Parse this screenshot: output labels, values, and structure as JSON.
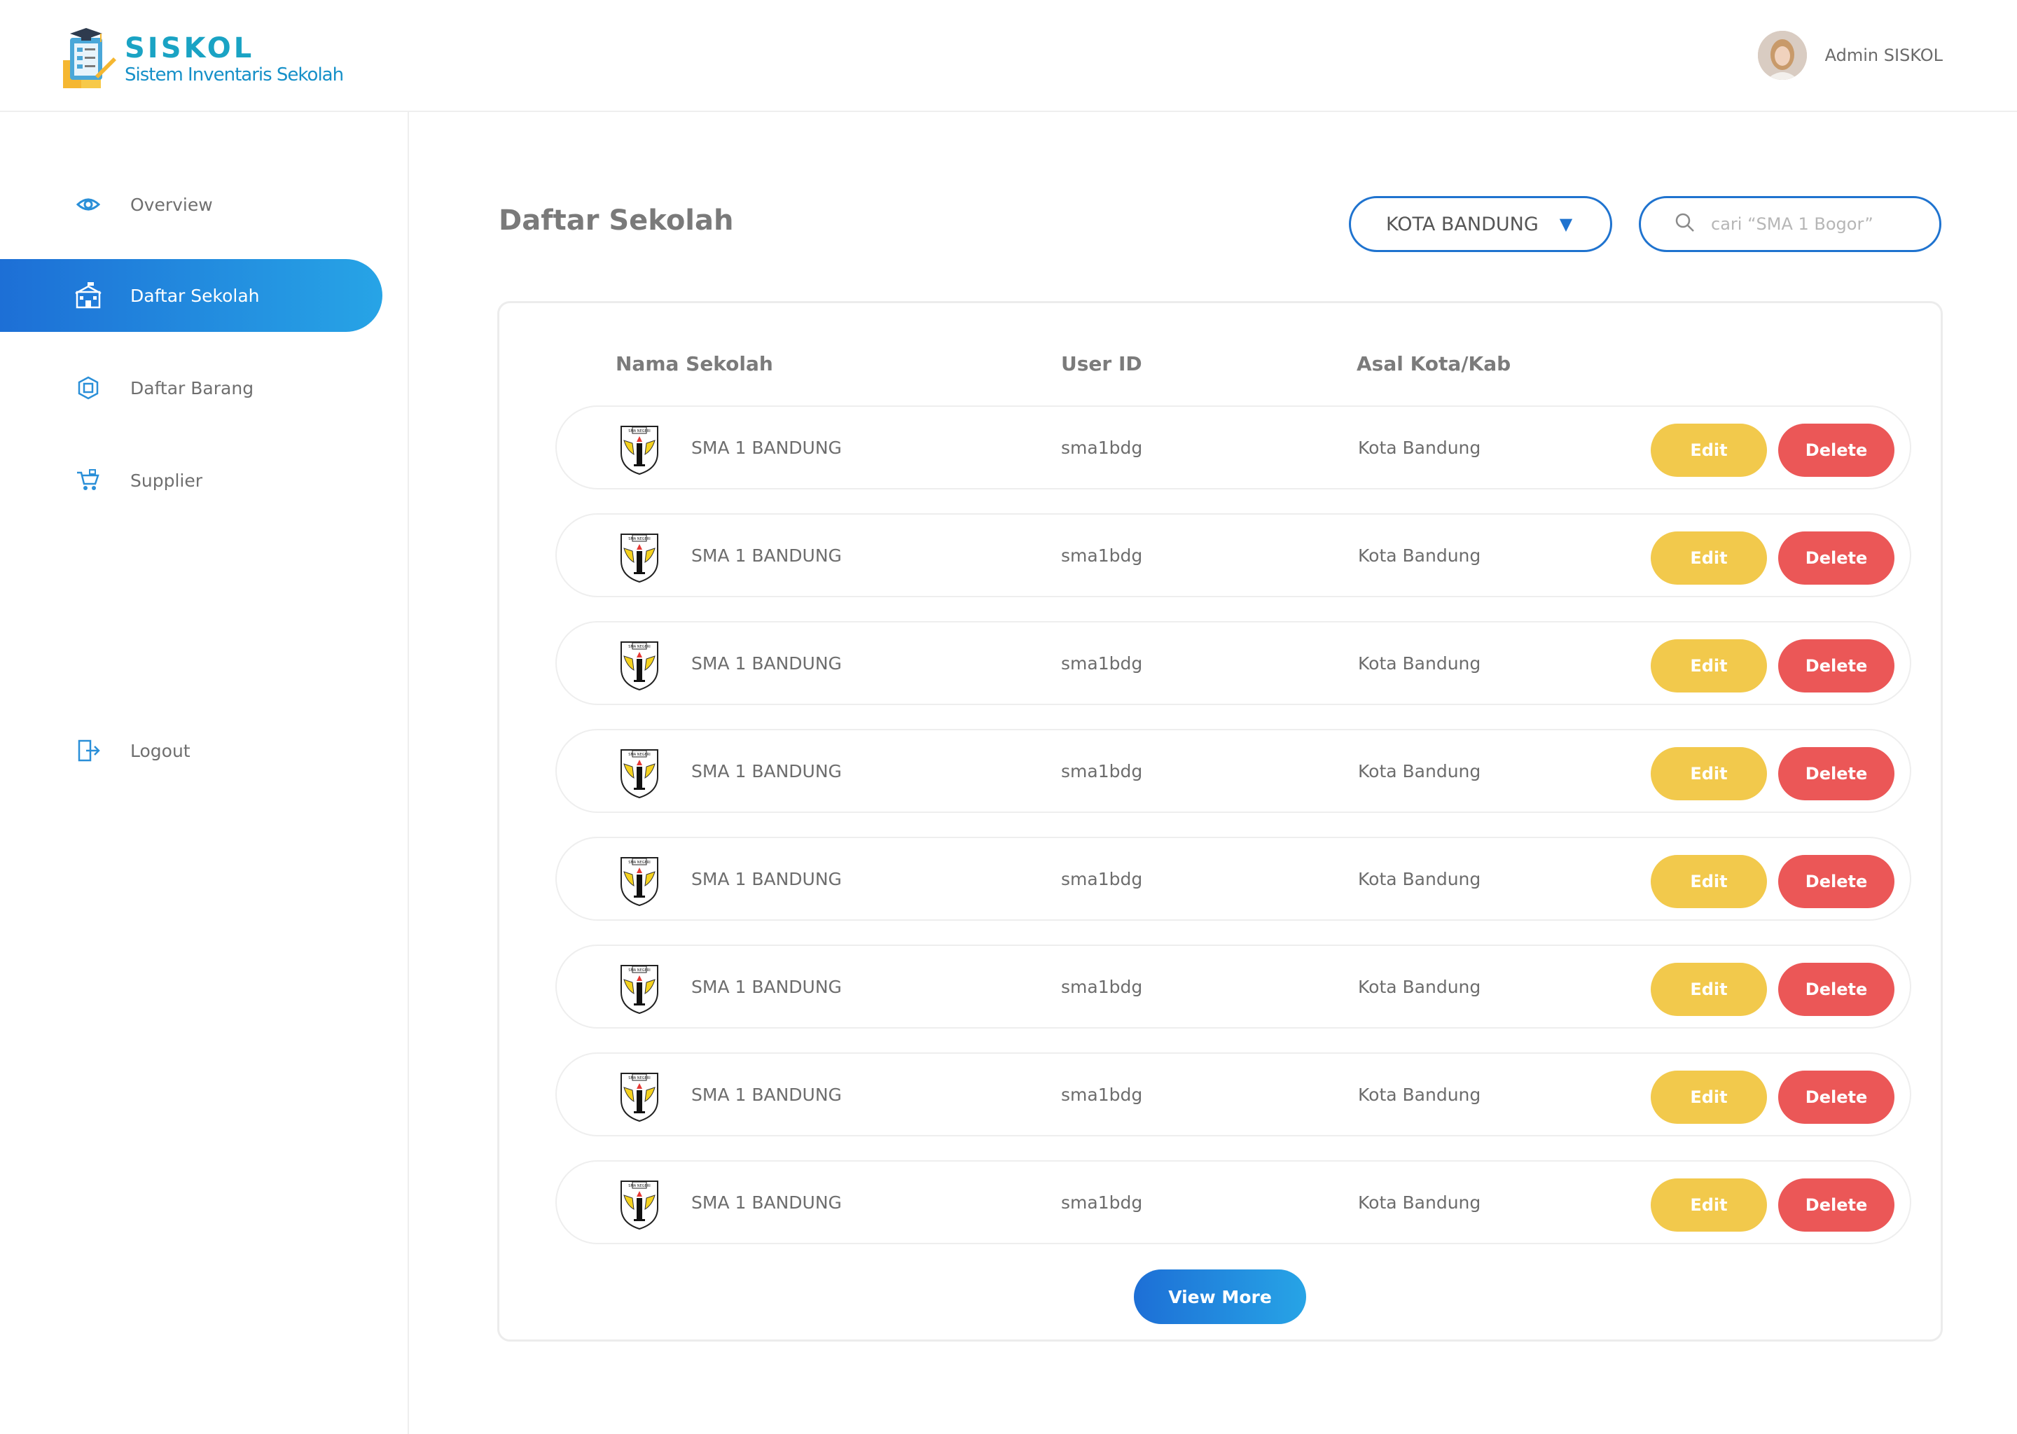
{
  "brand": {
    "title": "SISKOL",
    "subtitle": "Sistem Inventaris Sekolah"
  },
  "user": {
    "name": "Admin SISKOL"
  },
  "sidebar": {
    "items": [
      {
        "label": "Overview",
        "icon": "eye-icon"
      },
      {
        "label": "Daftar Sekolah",
        "icon": "school-icon",
        "active": true
      },
      {
        "label": "Daftar Barang",
        "icon": "box-icon"
      },
      {
        "label": "Supplier",
        "icon": "cart-icon"
      },
      {
        "label": "Logout",
        "icon": "logout-icon"
      }
    ]
  },
  "main": {
    "title": "Daftar Sekolah",
    "city_filter": {
      "selected": "KOTA BANDUNG"
    },
    "search": {
      "placeholder": "cari “SMA 1 Bogor”"
    },
    "table": {
      "headers": [
        "Nama Sekolah",
        "User ID",
        "Asal Kota/Kab"
      ],
      "rows": [
        {
          "name": "SMA 1 BANDUNG",
          "user_id": "sma1bdg",
          "city": "Kota Bandung"
        },
        {
          "name": "SMA 1 BANDUNG",
          "user_id": "sma1bdg",
          "city": "Kota Bandung"
        },
        {
          "name": "SMA 1 BANDUNG",
          "user_id": "sma1bdg",
          "city": "Kota Bandung"
        },
        {
          "name": "SMA 1 BANDUNG",
          "user_id": "sma1bdg",
          "city": "Kota Bandung"
        },
        {
          "name": "SMA 1 BANDUNG",
          "user_id": "sma1bdg",
          "city": "Kota Bandung"
        },
        {
          "name": "SMA 1 BANDUNG",
          "user_id": "sma1bdg",
          "city": "Kota Bandung"
        },
        {
          "name": "SMA 1 BANDUNG",
          "user_id": "sma1bdg",
          "city": "Kota Bandung"
        },
        {
          "name": "SMA 1 BANDUNG",
          "user_id": "sma1bdg",
          "city": "Kota Bandung"
        }
      ],
      "edit_label": "Edit",
      "delete_label": "Delete",
      "logo_text": "SMA NEGERI"
    },
    "view_more_label": "View More"
  },
  "colors": {
    "accent": "#1f73cf",
    "accent_gradient_end": "#27a4e6",
    "edit": "#f2c94c",
    "delete": "#eb5757",
    "brand": "#1aa3c4"
  }
}
